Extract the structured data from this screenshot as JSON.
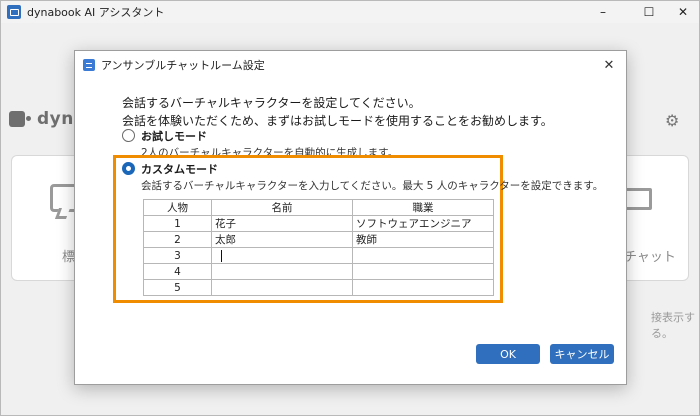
{
  "app": {
    "title": "dynabook AI アシスタント",
    "logo_text": "dyna",
    "card_left_text": "標",
    "card_right_text": "チャット",
    "side_note": "接表示する。"
  },
  "window_controls": {
    "minimize": "–",
    "maximize": "☐",
    "close": "✕"
  },
  "dialog": {
    "title": "アンサンブルチャットルーム設定",
    "close": "✕",
    "intro_line1": "会話するバーチャルキャラクターを設定してください。",
    "intro_line2": "会話を体験いただくため、まずはお試しモードを使用することをお勧めします。",
    "trial_mode": {
      "label": "お試しモード",
      "description": "2人のバーチャルキャラクターを自動的に生成します。",
      "selected": false
    },
    "custom_mode": {
      "label": "カスタムモード",
      "description": "会話するバーチャルキャラクターを入力してください。最大 5 人のキャラクターを設定できます。",
      "selected": true
    },
    "table": {
      "headers": [
        "人物",
        "名前",
        "職業"
      ],
      "rows": [
        {
          "num": "1",
          "name": "花子",
          "job": "ソフトウェアエンジニア"
        },
        {
          "num": "2",
          "name": "太郎",
          "job": "教師"
        },
        {
          "num": "3",
          "name": "",
          "job": ""
        },
        {
          "num": "4",
          "name": "",
          "job": ""
        },
        {
          "num": "5",
          "name": "",
          "job": ""
        }
      ]
    },
    "ok_label": "OK",
    "cancel_label": "キャンセル"
  },
  "colors": {
    "accent": "#2f6fbd",
    "highlight_border": "#f08c00"
  }
}
